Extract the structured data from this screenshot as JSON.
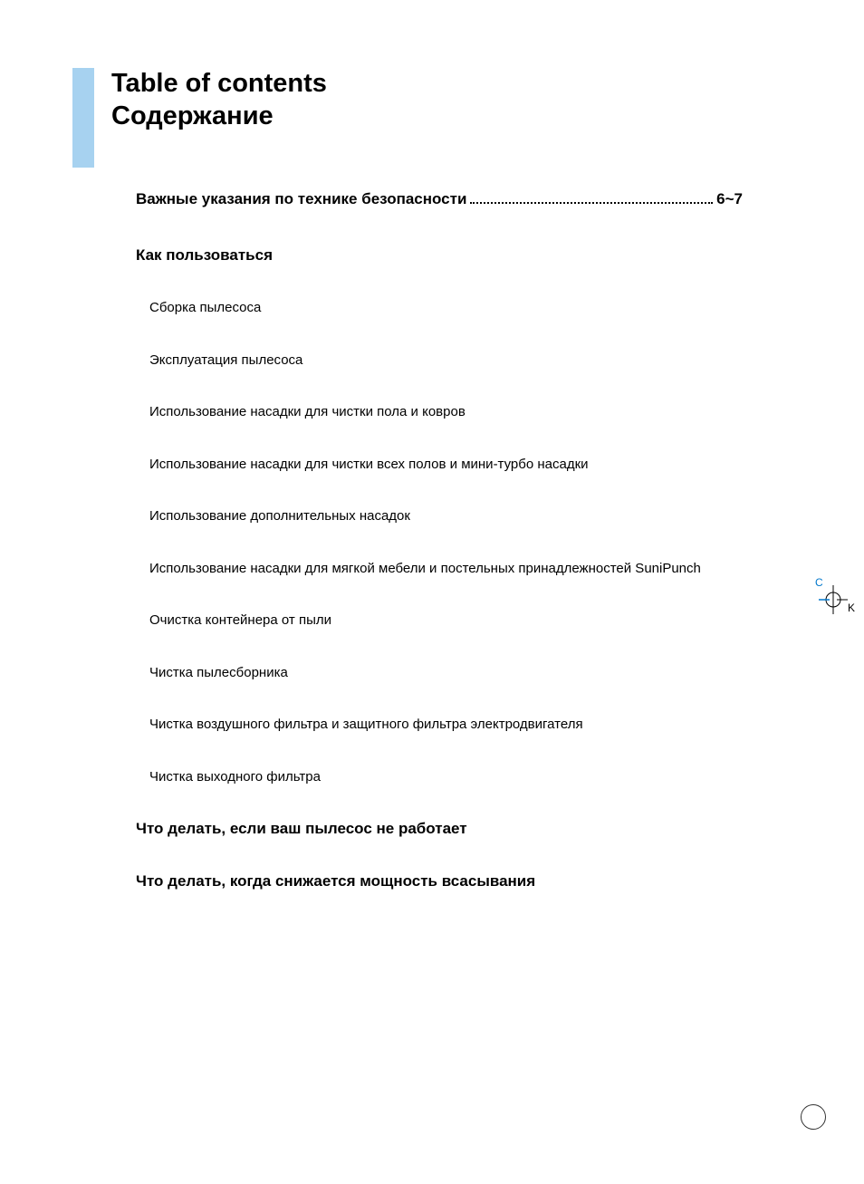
{
  "title": {
    "line1": "Table of contents",
    "line2": "Содержание"
  },
  "toc_entry": {
    "label": "Важные указания по технике безопасности",
    "page": "6~7"
  },
  "section_how_to_use": "Как пользоваться",
  "sub_items": [
    "Сборка пылесоса",
    "Эксплуатация пылесоса",
    "Использование насадки для чистки пола и ковров",
    "Использование насадки для чистки всех полов и мини-турбо насадки",
    "Использование дополнительных насадок",
    "Использование насадки для мягкой мебели и постельных принадлежностей SuniPunch",
    "Очистка контейнера от пыли",
    "Чистка пылесборника",
    "Чистка воздушного фильтра и защитного фильтра электродвигателя",
    "Чистка выходного фильтра"
  ],
  "trouble_1": "Что делать, если ваш пылесос не работает",
  "trouble_2": "Что делать, когда снижается мощность всасывания",
  "reg_mark": {
    "c": "C",
    "k": "K"
  }
}
